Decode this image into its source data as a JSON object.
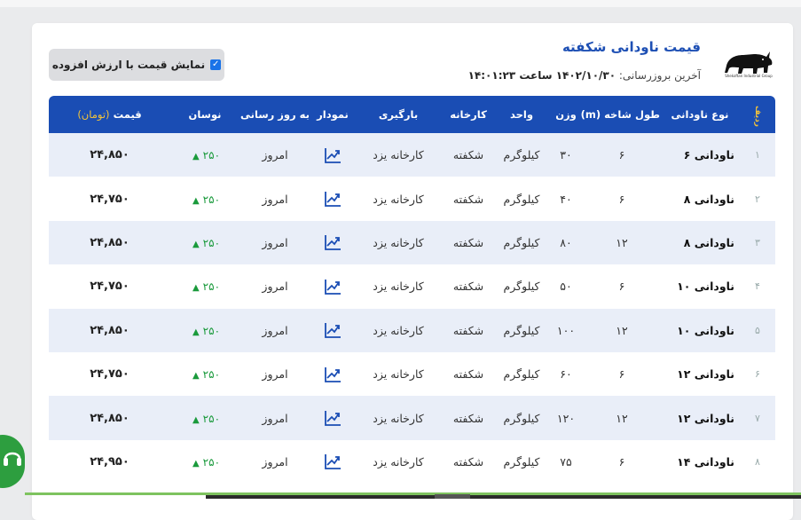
{
  "header": {
    "title": "قیمت ناودانی شکفته",
    "updated_label": "آخرین بروزرسانی:",
    "updated_value": "۱۴۰۲/۱۰/۳۰ ساعت ۱۴:۰۱:۲۳",
    "logo_caption": "Shekoftan Industrial Group",
    "vat_toggle_label": "نمایش قیمت با ارزش افزوده",
    "vat_checked": true
  },
  "table": {
    "headers": {
      "row": "ردیف",
      "type": "نوع ناودانی",
      "length": "طول شاخه (m)",
      "weight": "وزن",
      "unit": "واحد",
      "factory": "کارخانه",
      "loading": "بارگیری",
      "chart": "نمودار",
      "updated": "به روز رسانی",
      "change": "نوسان",
      "price": "قیمت",
      "price_unit": "(تومان)"
    },
    "rows": [
      {
        "idx": "۱",
        "type": "ناودانی ۶",
        "length": "۶",
        "weight": "۳۰",
        "unit": "کیلوگرم",
        "factory": "شکفته",
        "loading": "کارخانه یزد",
        "updated": "امروز",
        "change": "۲۵۰",
        "price": "۲۴,۸۵۰"
      },
      {
        "idx": "۲",
        "type": "ناودانی ۸",
        "length": "۶",
        "weight": "۴۰",
        "unit": "کیلوگرم",
        "factory": "شکفته",
        "loading": "کارخانه یزد",
        "updated": "امروز",
        "change": "۲۵۰",
        "price": "۲۴,۷۵۰"
      },
      {
        "idx": "۳",
        "type": "ناودانی ۸",
        "length": "۱۲",
        "weight": "۸۰",
        "unit": "کیلوگرم",
        "factory": "شکفته",
        "loading": "کارخانه یزد",
        "updated": "امروز",
        "change": "۲۵۰",
        "price": "۲۴,۸۵۰"
      },
      {
        "idx": "۴",
        "type": "ناودانی ۱۰",
        "length": "۶",
        "weight": "۵۰",
        "unit": "کیلوگرم",
        "factory": "شکفته",
        "loading": "کارخانه یزد",
        "updated": "امروز",
        "change": "۲۵۰",
        "price": "۲۴,۷۵۰"
      },
      {
        "idx": "۵",
        "type": "ناودانی ۱۰",
        "length": "۱۲",
        "weight": "۱۰۰",
        "unit": "کیلوگرم",
        "factory": "شکفته",
        "loading": "کارخانه یزد",
        "updated": "امروز",
        "change": "۲۵۰",
        "price": "۲۴,۸۵۰"
      },
      {
        "idx": "۶",
        "type": "ناودانی ۱۲",
        "length": "۶",
        "weight": "۶۰",
        "unit": "کیلوگرم",
        "factory": "شکفته",
        "loading": "کارخانه یزد",
        "updated": "امروز",
        "change": "۲۵۰",
        "price": "۲۴,۷۵۰"
      },
      {
        "idx": "۷",
        "type": "ناودانی ۱۲",
        "length": "۱۲",
        "weight": "۱۲۰",
        "unit": "کیلوگرم",
        "factory": "شکفته",
        "loading": "کارخانه یزد",
        "updated": "امروز",
        "change": "۲۵۰",
        "price": "۲۴,۸۵۰"
      },
      {
        "idx": "۸",
        "type": "ناودانی ۱۴",
        "length": "۶",
        "weight": "۷۵",
        "unit": "کیلوگرم",
        "factory": "شکفته",
        "loading": "کارخانه یزد",
        "updated": "امروز",
        "change": "۲۵۰",
        "price": "۲۴,۹۵۰"
      }
    ]
  },
  "colors": {
    "header_bg": "#1a4db4",
    "accent_yellow": "#f3c33a",
    "positive_green": "#1a9a3c",
    "striped_row": "#e9eef8"
  },
  "icons": {
    "chart": "trend-chart-icon",
    "change": "triangle-up-icon",
    "support": "headset-icon"
  }
}
